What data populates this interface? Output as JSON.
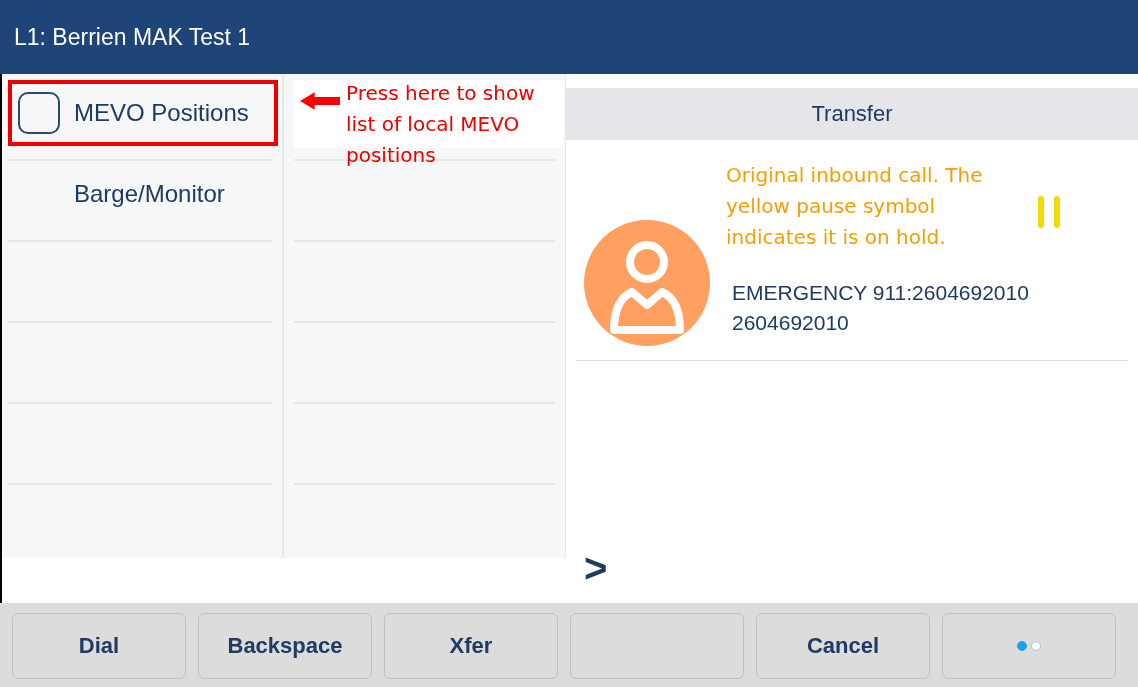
{
  "title_bar": {
    "title": "L1: Berrien MAK Test 1"
  },
  "menu": {
    "items": [
      {
        "label": "MEVO Positions",
        "kind": "checkbox",
        "checked": false,
        "annotated": true
      },
      {
        "label": "Barge/Monitor",
        "kind": "plain",
        "annotated": false
      }
    ]
  },
  "annotation": {
    "text": "Press here to show list of local MEVO positions"
  },
  "call_panel": {
    "header": "Transfer",
    "note": "Original inbound call. The yellow pause symbol indicates it is on hold.",
    "on_hold": true,
    "caller_name": "EMERGENCY 911:2604692010",
    "caller_number": "2604692010",
    "prompt": ">"
  },
  "softkeys": [
    {
      "kind": "label",
      "label": "Dial"
    },
    {
      "kind": "label",
      "label": "Backspace"
    },
    {
      "kind": "label",
      "label": "Xfer"
    },
    {
      "kind": "blank"
    },
    {
      "kind": "label",
      "label": "Cancel"
    },
    {
      "kind": "pager",
      "pages": [
        {
          "selected": true
        },
        {
          "selected": false
        }
      ]
    }
  ]
}
